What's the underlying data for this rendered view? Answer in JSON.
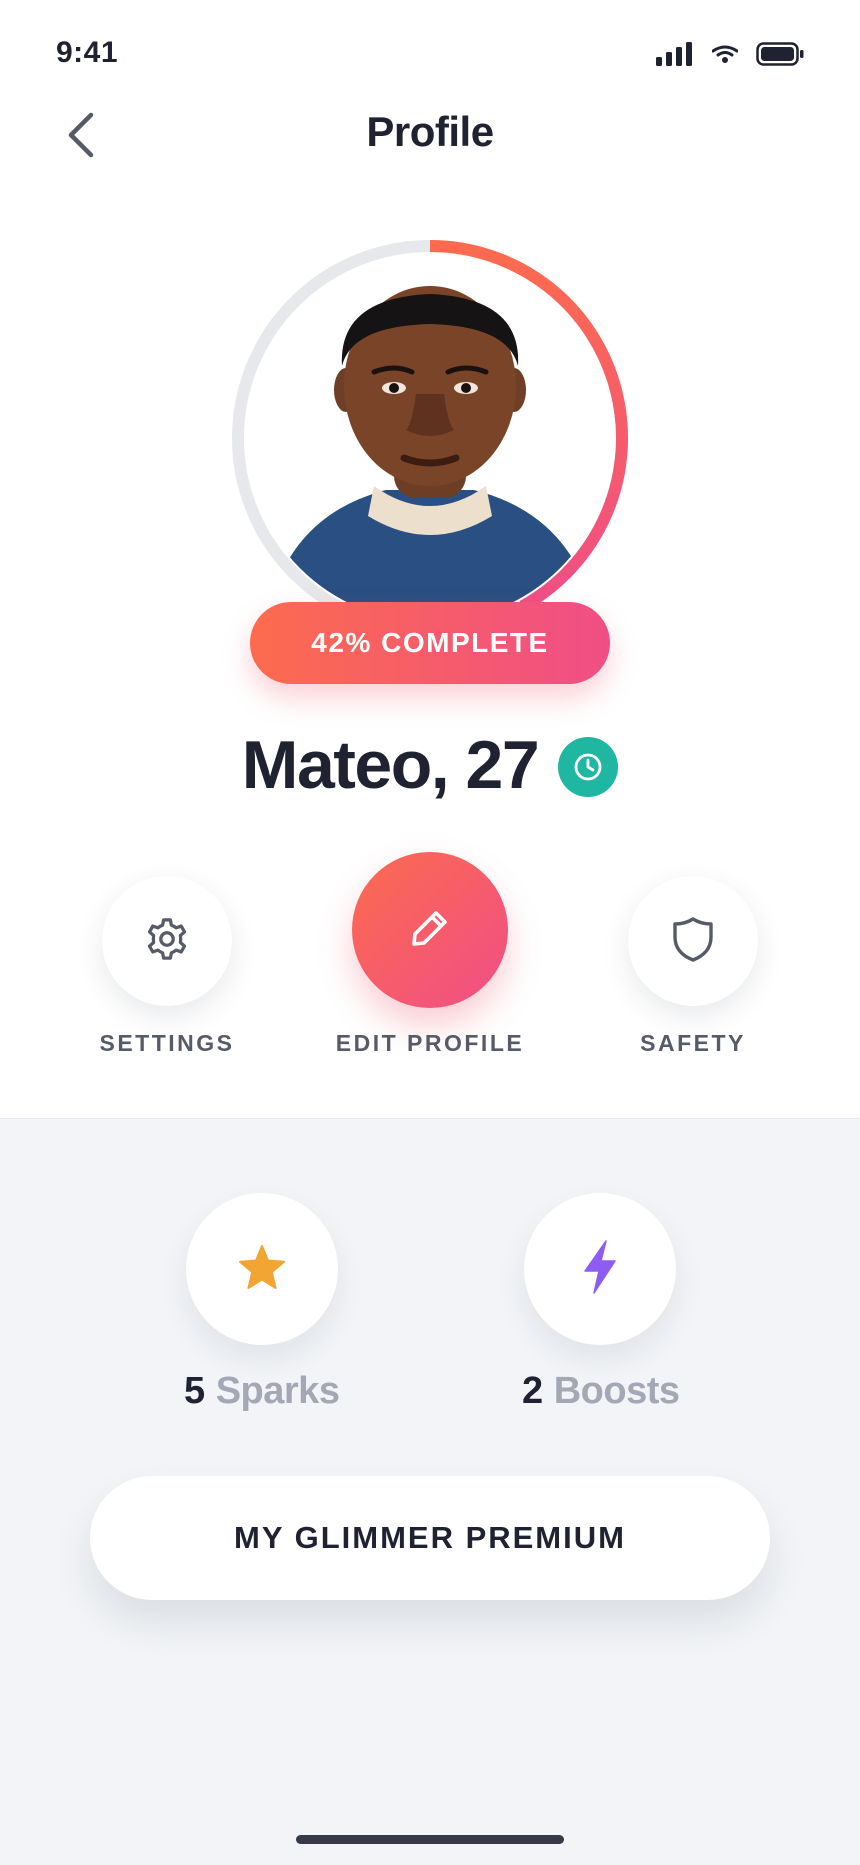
{
  "status_bar": {
    "time": "9:41",
    "icons": [
      "cellular-signal-icon",
      "wifi-icon",
      "battery-icon"
    ]
  },
  "header": {
    "title": "Profile",
    "back_icon": "chevron-left-icon"
  },
  "profile": {
    "completion_percent": 42,
    "completion_label": "42% COMPLETE",
    "name_age": "Mateo, 27",
    "verified_icon": "clock-icon",
    "ring_colors": {
      "track": "#e6e8ec",
      "start": "#fd6b4e",
      "end": "#ef4e86"
    }
  },
  "actions": [
    {
      "id": "settings",
      "label": "SETTINGS",
      "icon": "gear-icon"
    },
    {
      "id": "edit",
      "label": "EDIT PROFILE",
      "icon": "pencil-icon"
    },
    {
      "id": "safety",
      "label": "SAFETY",
      "icon": "shield-icon"
    }
  ],
  "stats": [
    {
      "count": "5",
      "label": "Sparks",
      "icon": "star-icon",
      "color": "#f2a533"
    },
    {
      "count": "2",
      "label": "Boosts",
      "icon": "lightning-icon",
      "color": "#8e5cf2"
    }
  ],
  "premium": {
    "label": "MY GLIMMER PREMIUM"
  },
  "colors": {
    "accent_start": "#fd6b4e",
    "accent_end": "#ef4e86",
    "verified": "#1fb7a2",
    "text_dark": "#1f2230",
    "text_muted": "#a3a8b4",
    "background_lower": "#f2f4f7"
  }
}
